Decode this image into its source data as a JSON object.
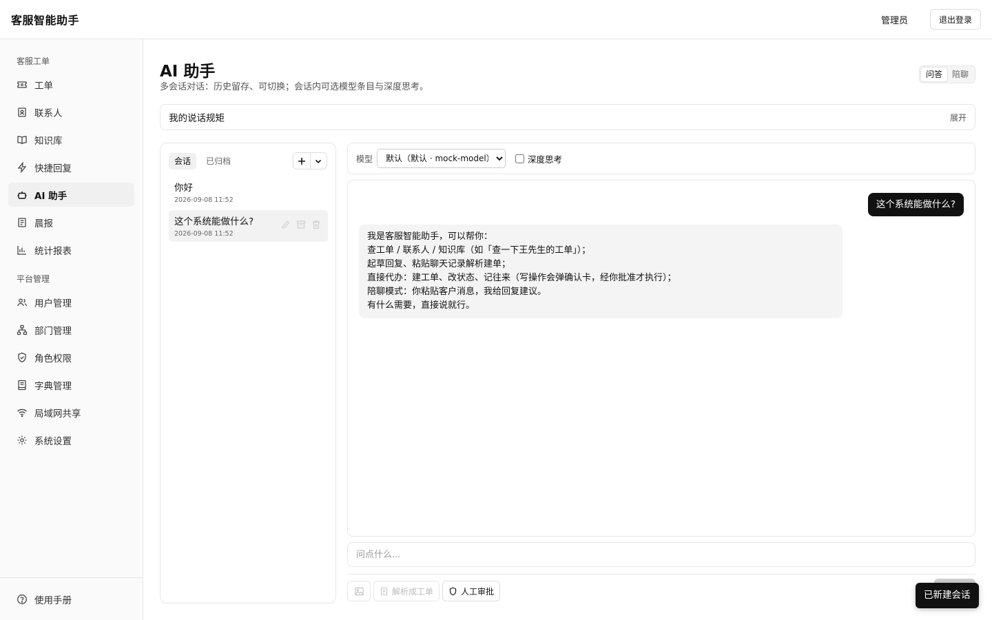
{
  "app": {
    "title": "客服智能助手"
  },
  "header": {
    "user": "管理员",
    "logout_label": "退出登录"
  },
  "sidebar": {
    "sections": [
      {
        "title": "客服工单",
        "items": [
          {
            "label": "工单",
            "icon": "ticket-icon"
          },
          {
            "label": "联系人",
            "icon": "contact-book-icon"
          },
          {
            "label": "知识库",
            "icon": "book-open-icon"
          },
          {
            "label": "快捷回复",
            "icon": "lightning-icon"
          },
          {
            "label": "AI 助手",
            "icon": "bot-icon",
            "active": true
          },
          {
            "label": "晨报",
            "icon": "newspaper-icon"
          },
          {
            "label": "统计报表",
            "icon": "bar-chart-icon"
          }
        ]
      },
      {
        "title": "平台管理",
        "items": [
          {
            "label": "用户管理",
            "icon": "users-icon"
          },
          {
            "label": "部门管理",
            "icon": "org-tree-icon"
          },
          {
            "label": "角色权限",
            "icon": "shield-check-icon"
          },
          {
            "label": "字典管理",
            "icon": "notebook-icon"
          },
          {
            "label": "局域网共享",
            "icon": "wifi-icon"
          },
          {
            "label": "系统设置",
            "icon": "gear-icon"
          }
        ]
      }
    ],
    "footer": {
      "label": "使用手册",
      "icon": "help-circle-icon"
    }
  },
  "main": {
    "title": "AI 助手",
    "subtitle": "多会话对话：历史留存、可切换；会话内可选模型条目与深度思考。",
    "mode_tabs": [
      "问答",
      "陪聊"
    ],
    "active_mode": "问答",
    "rules": {
      "title": "我的说话规矩",
      "expand_label": "展开"
    }
  },
  "conversations": {
    "tabs": [
      "会话",
      "已归档"
    ],
    "active_tab": "会话",
    "items": [
      {
        "title": "你好",
        "time": "2026-09-08 11:52"
      },
      {
        "title": "这个系统能做什么?",
        "time": "2026-09-08 11:52",
        "active": true
      }
    ]
  },
  "chat": {
    "model_label": "模型",
    "model_value": "默认（默认 · mock-model）",
    "deep_think_label": "深度思考",
    "deep_think_checked": false,
    "messages": [
      {
        "role": "user",
        "text": "这个系统能做什么?"
      },
      {
        "role": "assistant",
        "lines": [
          "我是客服智能助手，可以帮你：",
          "查工单 / 联系人 / 知识库（如「查一下王先生的工单」）；",
          "起草回复、粘贴聊天记录解析建单；",
          "直接代办：建工单、改状态、记往来（写操作会弹确认卡，经你批准才执行）；",
          "陪聊模式：你粘贴客户消息，我给回复建议。",
          "有什么需要，直接说就行。"
        ]
      }
    ],
    "input_placeholder": "问点什么...",
    "toolbar": {
      "parse_ticket_label": "解析成工单",
      "manual_approval_label": "人工审批"
    }
  },
  "toast": {
    "text": "已新建会话"
  }
}
